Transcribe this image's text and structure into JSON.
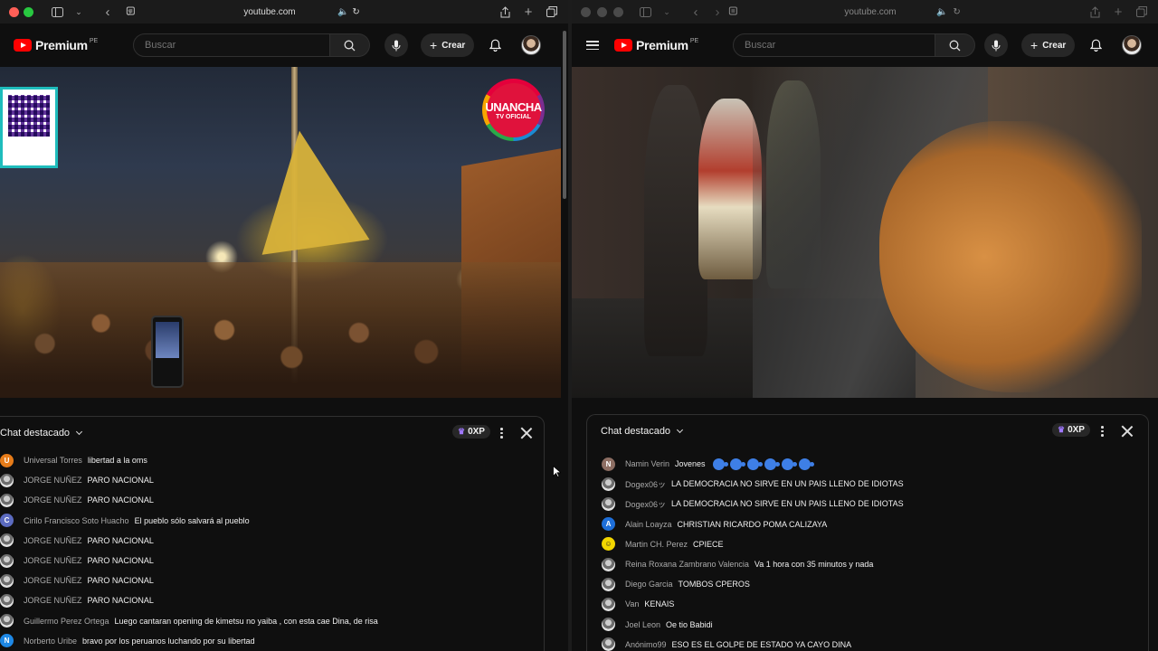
{
  "left": {
    "url": "youtube.com",
    "logo": {
      "text": "Premium",
      "region": "PE"
    },
    "search_placeholder": "Buscar",
    "create_label": "Crear",
    "video_overlay": {
      "channel_name": "UNANCHA",
      "channel_sub": "TV OFICIAL"
    },
    "chat": {
      "title": "Chat destacado",
      "xp": "0XP",
      "messages": [
        {
          "author": "Universal Torres",
          "text": "libertad a la oms",
          "avatar": "U",
          "color": "#e67c1a"
        },
        {
          "author": "JORGE NUÑEZ",
          "text": "PARO NACIONAL",
          "avatar": "",
          "color": ""
        },
        {
          "author": "JORGE NUÑEZ",
          "text": "PARO NACIONAL",
          "avatar": "",
          "color": ""
        },
        {
          "author": "Cirilo Francisco Soto Huacho",
          "text": "El pueblo sólo salvará al pueblo",
          "avatar": "C",
          "color": "#5c6bc0"
        },
        {
          "author": "JORGE NUÑEZ",
          "text": "PARO NACIONAL",
          "avatar": "",
          "color": ""
        },
        {
          "author": "JORGE NUÑEZ",
          "text": "PARO NACIONAL",
          "avatar": "",
          "color": ""
        },
        {
          "author": "JORGE NUÑEZ",
          "text": "PARO NACIONAL",
          "avatar": "",
          "color": ""
        },
        {
          "author": "JORGE NUÑEZ",
          "text": "PARO NACIONAL",
          "avatar": "",
          "color": ""
        },
        {
          "author": "Guillermo Perez Ortega",
          "text": "Luego cantaran opening de kimetsu no yaiba , con esta cae Dina, de risa",
          "avatar": "",
          "color": ""
        },
        {
          "author": "Norberto Uribe",
          "text": "bravo por los peruanos luchando por su libertad",
          "avatar": "N",
          "color": "#1e88e5"
        }
      ]
    }
  },
  "right": {
    "url": "youtube.com",
    "logo": {
      "text": "Premium",
      "region": "PE"
    },
    "search_placeholder": "Buscar",
    "create_label": "Crear",
    "chat": {
      "title": "Chat destacado",
      "xp": "0XP",
      "messages": [
        {
          "author": "Namin Verin",
          "text": "Jovenes",
          "avatar": "N",
          "color": "#8d6e63",
          "emoji_count": 6
        },
        {
          "author": "Dogex06ッ",
          "text": "LA DEMOCRACIA NO SIRVE EN UN PAIS LLENO DE IDIOTAS",
          "avatar": "",
          "color": ""
        },
        {
          "author": "Dogex06ッ",
          "text": "LA DEMOCRACIA NO SIRVE EN UN PAIS LLENO DE IDIOTAS",
          "avatar": "",
          "color": ""
        },
        {
          "author": "Alain Loayza",
          "text": "CHRISTIAN RICARDO POMA CALIZAYA",
          "avatar": "A",
          "color": "#1e6fd9"
        },
        {
          "author": "Martin CH. Perez",
          "text": "CPIECE",
          "avatar": "☺",
          "color": "#f2d600"
        },
        {
          "author": "Reina Roxana Zambrano Valencia",
          "text": "Va 1 hora con 35 minutos y nada",
          "avatar": "",
          "color": ""
        },
        {
          "author": "Diego Garcia",
          "text": "TOMBOS CPEROS",
          "avatar": "",
          "color": ""
        },
        {
          "author": "Van",
          "text": "KENAIS",
          "avatar": "",
          "color": ""
        },
        {
          "author": "Joel Leon",
          "text": "Oe tio Babidi",
          "avatar": "",
          "color": ""
        },
        {
          "author": "Anónimo99",
          "text": "ESO ES EL GOLPE DE ESTADO YA CAYO DINA",
          "avatar": "",
          "color": ""
        }
      ]
    }
  },
  "colors": {
    "brand_red": "#ff0000",
    "background": "#0f0f0f",
    "text_primary": "#f1f1f1",
    "text_secondary": "#aaaaaa"
  }
}
